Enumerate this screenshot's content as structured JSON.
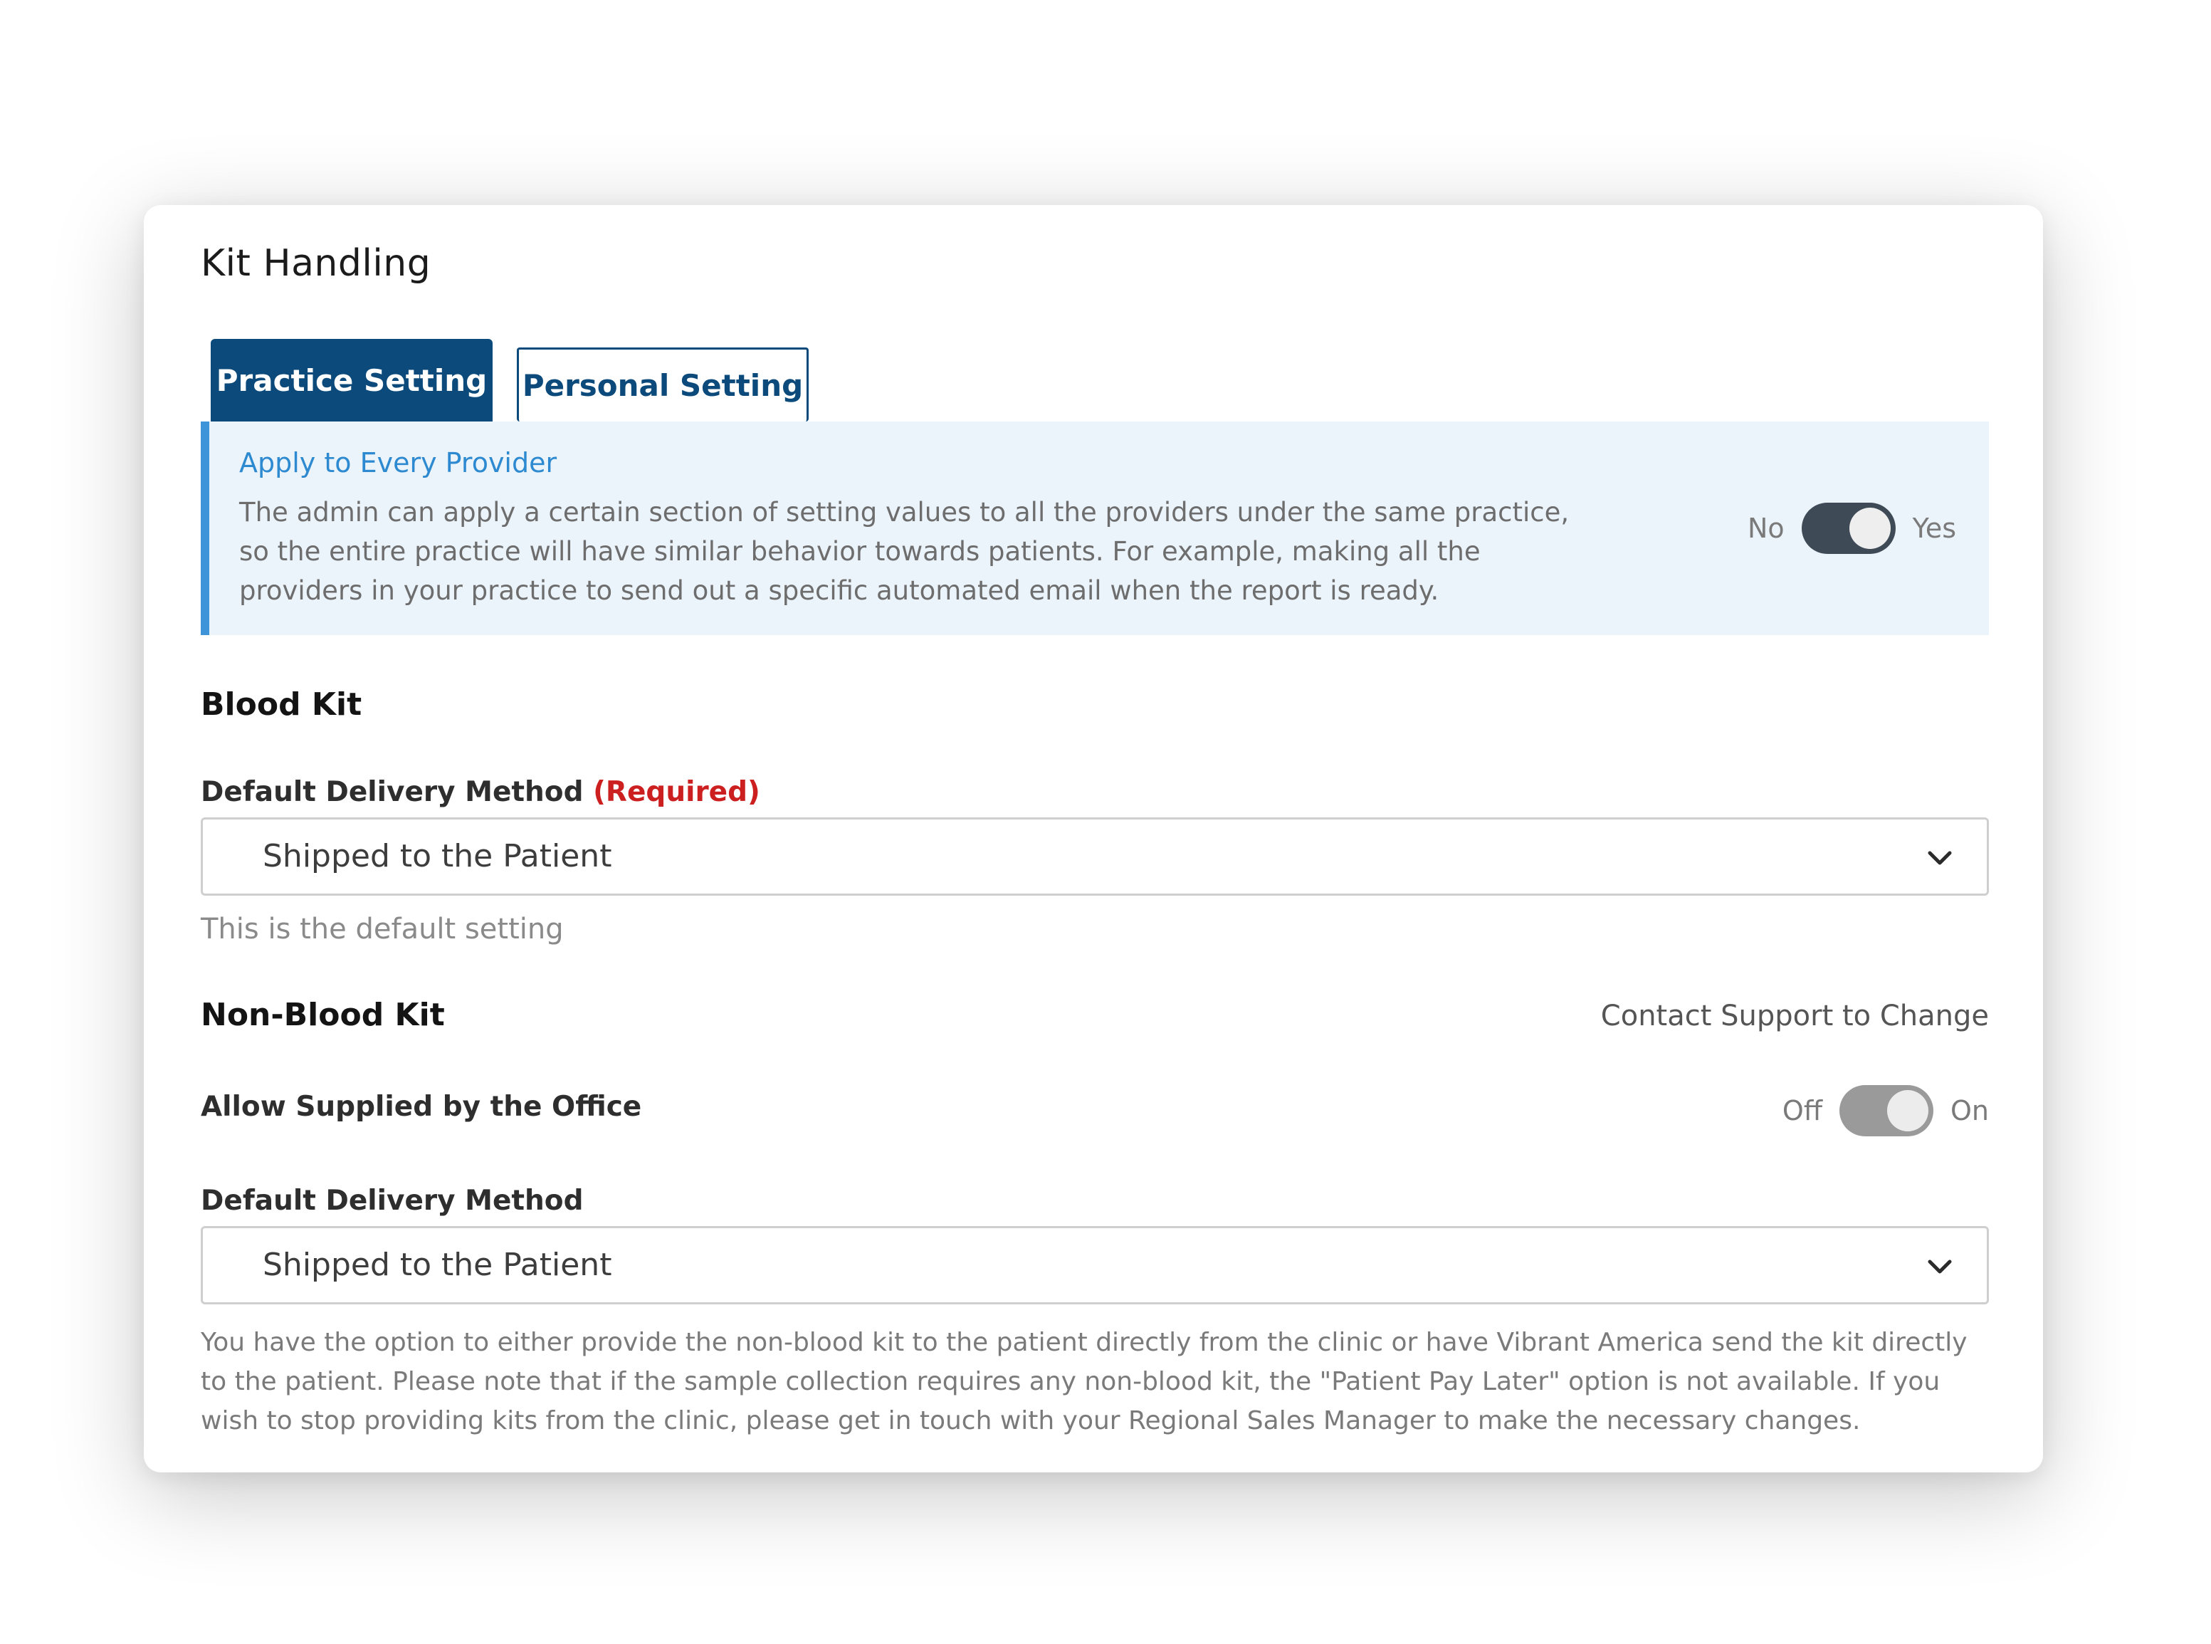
{
  "panel": {
    "title": "Kit Handling",
    "tabs": [
      {
        "label": "Practice Setting",
        "active": true
      },
      {
        "label": "Personal Setting",
        "active": false
      }
    ]
  },
  "apply_banner": {
    "title": "Apply to Every Provider",
    "description": "The admin can apply a certain section of setting values to all the providers under the same practice, so the entire practice will have similar behavior towards patients. For example, making all the providers in your practice to send out a specific automated email when the report is ready.",
    "toggle": {
      "off_label": "No",
      "on_label": "Yes",
      "state": "on"
    }
  },
  "blood_kit": {
    "heading": "Blood Kit",
    "delivery_label": "Default Delivery Method",
    "required_tag": "(Required)",
    "delivery_value": "Shipped to the Patient",
    "hint": "This is the default setting"
  },
  "non_blood_kit": {
    "heading": "Non-Blood Kit",
    "contact_note": "Contact Support to Change",
    "allow_label": "Allow Supplied by the Office",
    "toggle": {
      "off_label": "Off",
      "on_label": "On",
      "state": "on-disabled"
    },
    "delivery_label": "Default Delivery Method",
    "delivery_value": "Shipped to the Patient",
    "footnote": "You have the option to either provide the non-blood kit to the patient directly from the clinic or have Vibrant America send the kit directly to the patient. Please note that if the sample collection requires any non-blood kit, the \"Patient Pay Later\" option is not available. If you wish to stop providing kits from the clinic, please get in touch with your Regional Sales Manager to make the necessary changes."
  },
  "colors": {
    "tab_active": "#0b4a7a",
    "banner_bg": "#ebf3fb",
    "banner_accent": "#3d94d9",
    "required": "#cc1f1f",
    "toggle_on": "#3f4a57",
    "toggle_disabled": "#9a9a9a"
  }
}
